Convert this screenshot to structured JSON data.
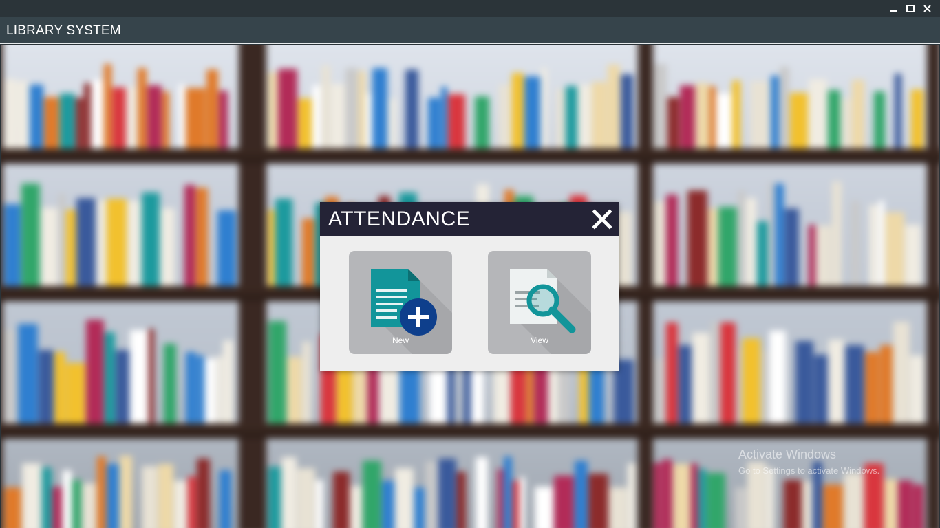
{
  "window": {
    "title": "LIBRARY SYSTEM",
    "controls": [
      "minimize-icon",
      "maximize-icon",
      "close-icon"
    ]
  },
  "dialog": {
    "title": "ATTENDANCE",
    "close_icon": "close-icon",
    "tiles": [
      {
        "label": "New",
        "icon": "new-document-icon"
      },
      {
        "label": "View",
        "icon": "view-document-icon"
      }
    ]
  },
  "watermark": {
    "title": "Activate Windows",
    "subtitle": "Go to Settings to activate Windows."
  },
  "colors": {
    "titlebar": "#36444b",
    "dialog_header": "#242336",
    "tile_bg": "#b5b6b9",
    "icon_teal": "#12959a",
    "icon_navy": "#0e3f8c"
  }
}
